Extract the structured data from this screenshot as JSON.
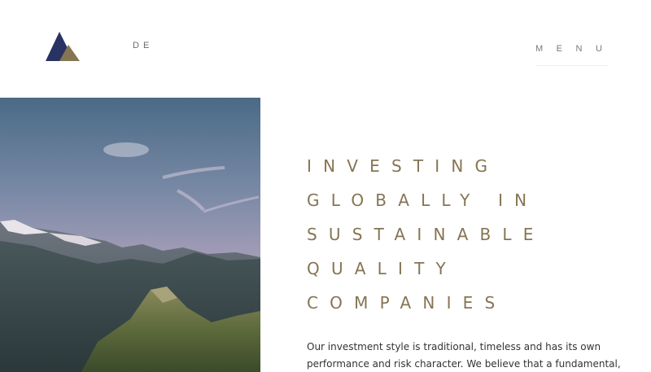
{
  "header": {
    "logo_icon": "mountain-triangle-logo-icon",
    "language_label": "DE",
    "menu_label": "MENU"
  },
  "hero": {
    "image": "alpine-mountain-landscape-photo",
    "headline_lines": [
      "INVESTING",
      "GLOBALLY IN",
      "SUSTAINABLE",
      "QUALITY",
      "COMPANIES"
    ],
    "intro_lines": [
      "Our investment style is traditional, timeless and has its own",
      "performance and risk character. We believe that a fundamental,"
    ]
  },
  "colors": {
    "brand_navy": "#283263",
    "brand_gold": "#867552",
    "headline_text": "#857553",
    "body_text": "#333333"
  }
}
